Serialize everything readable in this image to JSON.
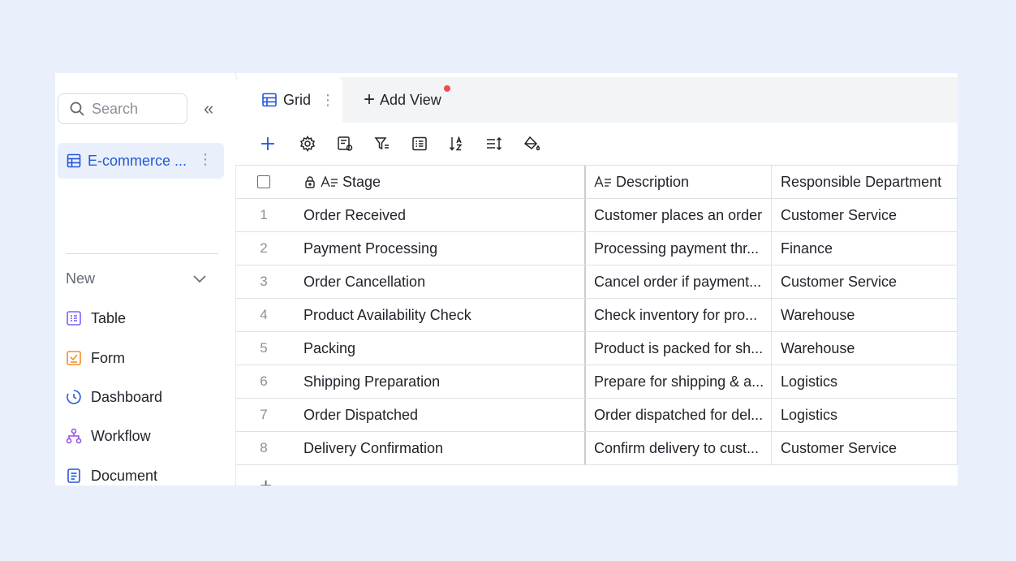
{
  "sidebar": {
    "search_placeholder": "Search",
    "selected_item": "E-commerce ...",
    "new_label": "New",
    "create_items": [
      {
        "label": "Table",
        "icon": "table-icon",
        "color": "#7b61ff"
      },
      {
        "label": "Form",
        "icon": "form-icon",
        "color": "#f58d2c"
      },
      {
        "label": "Dashboard",
        "icon": "dashboard-icon",
        "color": "#2457d6"
      },
      {
        "label": "Workflow",
        "icon": "workflow-icon",
        "color": "#9b51e0"
      },
      {
        "label": "Document",
        "icon": "document-icon",
        "color": "#2457d6"
      }
    ]
  },
  "tabs": {
    "active": "Grid",
    "add_view": "Add View"
  },
  "table": {
    "columns": [
      "Stage",
      "Description",
      "Responsible Department"
    ],
    "rows": [
      {
        "num": "1",
        "stage": "Order Received",
        "description": "Customer places an order",
        "department": "Customer Service"
      },
      {
        "num": "2",
        "stage": "Payment Processing",
        "description": "Processing payment thr...",
        "department": "Finance"
      },
      {
        "num": "3",
        "stage": "Order Cancellation",
        "description": "Cancel order if payment...",
        "department": "Customer Service"
      },
      {
        "num": "4",
        "stage": "Product Availability Check",
        "description": "Check inventory for pro...",
        "department": "Warehouse"
      },
      {
        "num": "5",
        "stage": "Packing",
        "description": "Product is packed for sh...",
        "department": "Warehouse"
      },
      {
        "num": "6",
        "stage": "Shipping Preparation",
        "description": "Prepare for shipping & a...",
        "department": "Logistics"
      },
      {
        "num": "7",
        "stage": "Order Dispatched",
        "description": "Order dispatched for del...",
        "department": "Logistics"
      },
      {
        "num": "8",
        "stage": "Delivery Confirmation",
        "description": "Confirm delivery to cust...",
        "department": "Customer Service"
      }
    ]
  },
  "colors": {
    "accent": "#2457d6",
    "background": "#e9f0fc",
    "notification_dot": "#f54a45"
  }
}
